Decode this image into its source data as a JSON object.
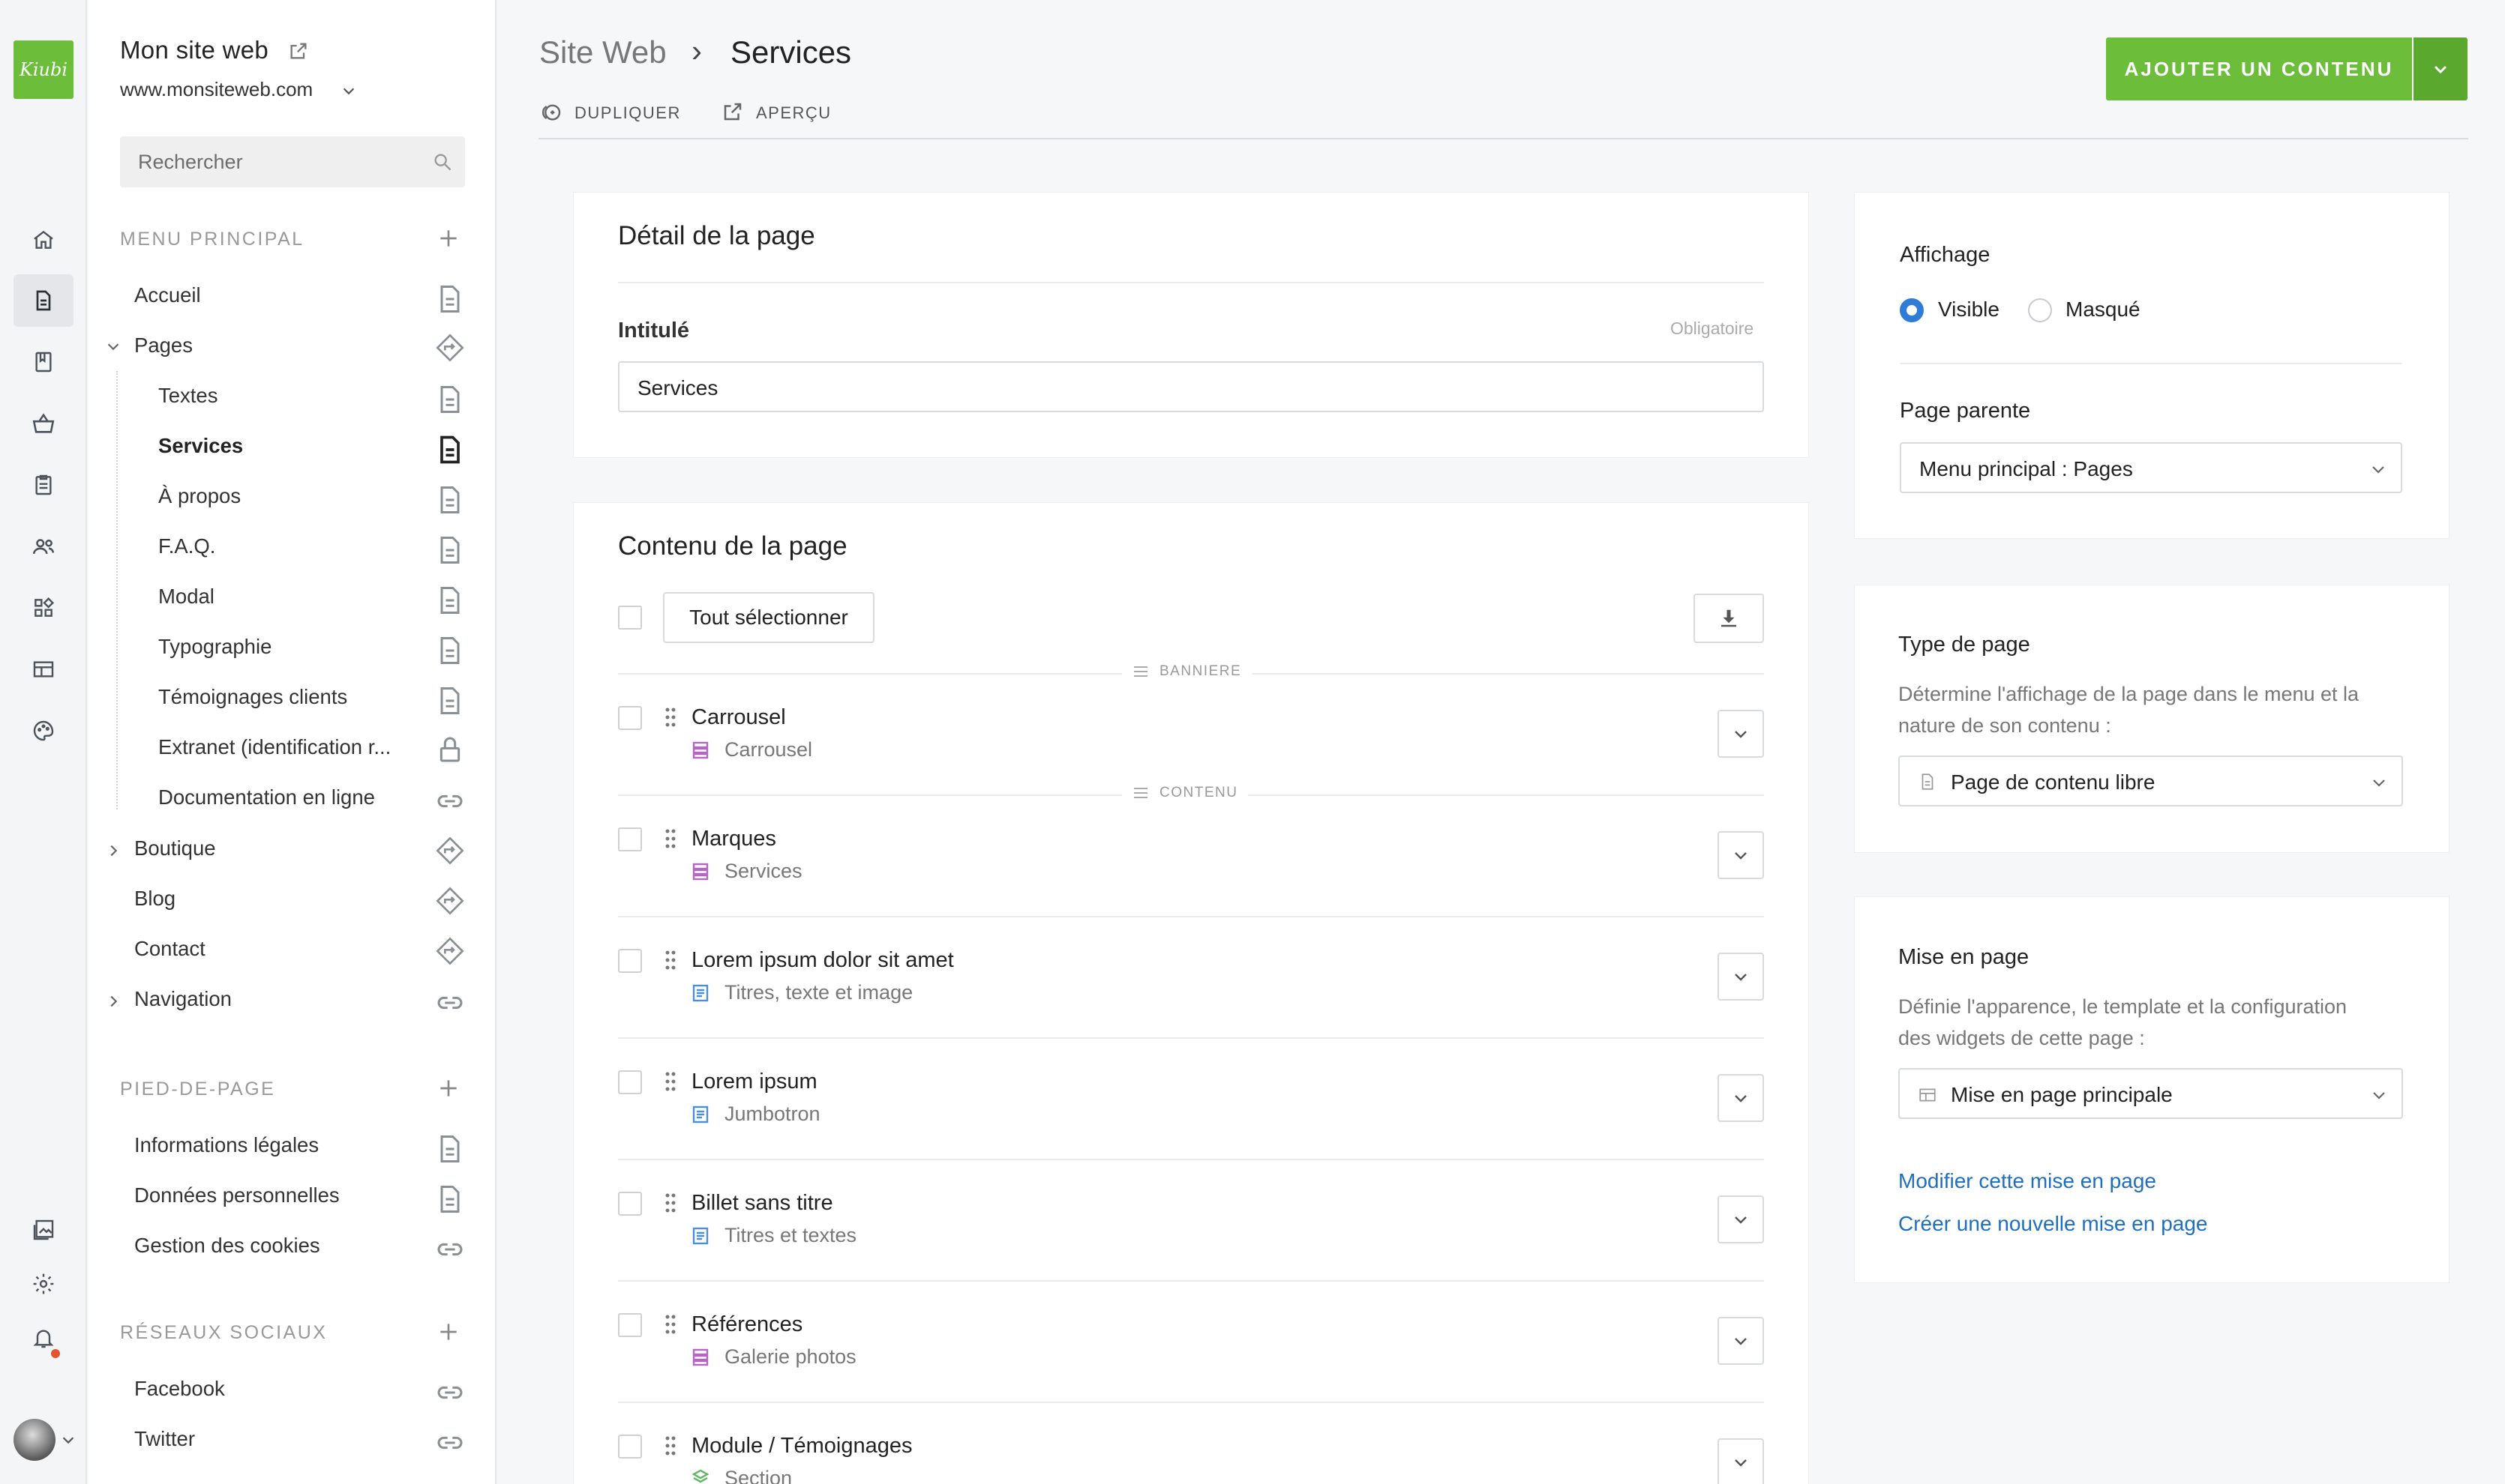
{
  "app": {
    "logo_text": "Kiubi"
  },
  "rail": {
    "icons": [
      "home-icon",
      "pages-icon",
      "blog-icon",
      "shop-icon",
      "orders-icon",
      "users-icon",
      "widgets-icon",
      "layout-icon",
      "theme-icon",
      "media-icon",
      "settings-icon",
      "notifications-icon"
    ],
    "notification_dot_color": "#e2552d"
  },
  "site": {
    "name": "Mon site web",
    "url": "www.monsiteweb.com"
  },
  "search": {
    "placeholder": "Rechercher"
  },
  "menus": {
    "main": {
      "title": "MENU PRINCIPAL",
      "items": [
        {
          "label": "Accueil",
          "icon": "page-icon"
        },
        {
          "label": "Pages",
          "icon": "directions-icon",
          "expanded": true
        },
        {
          "label": "Textes",
          "icon": "page-icon"
        },
        {
          "label": "Services",
          "icon": "page-icon",
          "selected": true
        },
        {
          "label": "À propos",
          "icon": "page-icon"
        },
        {
          "label": "F.A.Q.",
          "icon": "page-icon"
        },
        {
          "label": "Modal",
          "icon": "page-icon"
        },
        {
          "label": "Typographie",
          "icon": "page-icon"
        },
        {
          "label": "Témoignages clients",
          "icon": "page-icon"
        },
        {
          "label": "Extranet (identification r...",
          "icon": "lock-icon"
        },
        {
          "label": "Documentation en ligne",
          "icon": "link-icon"
        },
        {
          "label": "Boutique",
          "icon": "directions-icon",
          "expanded": false
        },
        {
          "label": "Blog",
          "icon": "directions-icon"
        },
        {
          "label": "Contact",
          "icon": "directions-icon"
        },
        {
          "label": "Navigation",
          "icon": "link-icon",
          "expanded": false
        }
      ]
    },
    "footer": {
      "title": "PIED-DE-PAGE",
      "items": [
        {
          "label": "Informations légales",
          "icon": "page-icon"
        },
        {
          "label": "Données personnelles",
          "icon": "page-icon"
        },
        {
          "label": "Gestion des cookies",
          "icon": "link-icon"
        }
      ]
    },
    "social": {
      "title": "RÉSEAUX SOCIAUX",
      "items": [
        {
          "label": "Facebook",
          "icon": "link-icon"
        },
        {
          "label": "Twitter",
          "icon": "link-icon"
        }
      ]
    }
  },
  "header": {
    "breadcrumb_parent": "Site Web",
    "breadcrumb_separator": "›",
    "title": "Services",
    "actions": {
      "duplicate": "DUPLIQUER",
      "preview": "APERÇU"
    },
    "add_button": "AJOUTER UN CONTENU",
    "accent_color": "#6bbd3a"
  },
  "detail": {
    "title": "Détail de la page",
    "field_label": "Intitulé",
    "required_hint": "Obligatoire",
    "field_value": "Services"
  },
  "content": {
    "title": "Contenu de la page",
    "select_all": "Tout sélectionner",
    "dividers": [
      "BANNIERE",
      "CONTENU"
    ],
    "blocks": [
      {
        "name": "Carrousel",
        "type": "Carrousel",
        "type_icon": "stack-icon",
        "type_color": "#b565c4"
      },
      {
        "name": "Marques",
        "type": "Services",
        "type_icon": "stack-icon",
        "type_color": "#b565c4"
      },
      {
        "name": "Lorem ipsum dolor sit amet",
        "type": "Titres, texte et image",
        "type_icon": "text-block-icon",
        "type_color": "#4a90d9"
      },
      {
        "name": "Lorem ipsum",
        "type": "Jumbotron",
        "type_icon": "text-block-icon",
        "type_color": "#4a90d9"
      },
      {
        "name": "Billet sans titre",
        "type": "Titres et textes",
        "type_icon": "text-block-icon",
        "type_color": "#4a90d9"
      },
      {
        "name": "Références",
        "type": "Galerie photos",
        "type_icon": "stack-icon",
        "type_color": "#b565c4"
      },
      {
        "name": "Module / Témoignages",
        "type": "Section",
        "type_icon": "section-icon",
        "type_color": "#5cb85c"
      }
    ]
  },
  "right": {
    "display": {
      "title": "Affichage",
      "options": [
        "Visible",
        "Masqué"
      ],
      "selected": "Visible"
    },
    "parent": {
      "title": "Page parente",
      "value": "Menu principal : Pages"
    },
    "type": {
      "title": "Type de page",
      "description_lines": [
        "Détermine l'affichage de la page dans le menu et la",
        "nature de son contenu :"
      ],
      "value": "Page de contenu libre"
    },
    "layout": {
      "title": "Mise en page",
      "description_lines": [
        "Définie l'apparence, le template et la configuration",
        "des widgets de cette page :"
      ],
      "value": "Mise en page principale",
      "links": [
        "Modifier cette mise en page",
        "Créer une nouvelle mise en page"
      ]
    }
  }
}
